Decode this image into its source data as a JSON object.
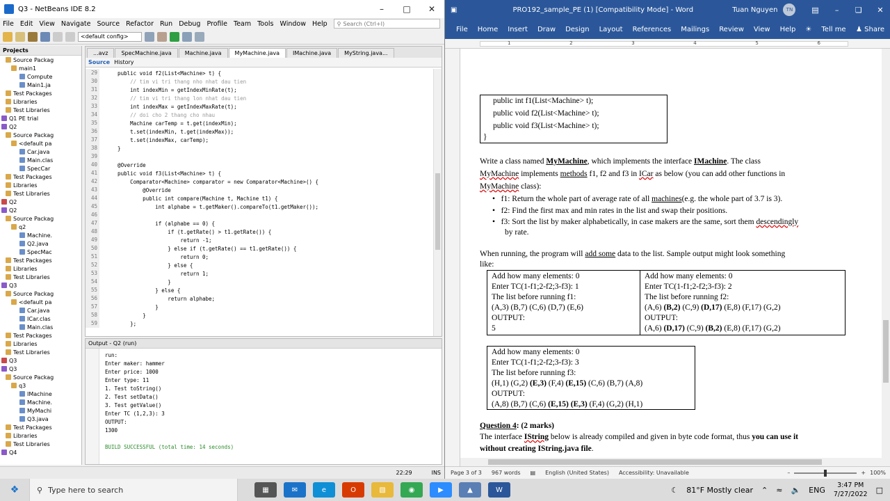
{
  "netbeans": {
    "title": "Q3 - NetBeans IDE 8.2",
    "menu": [
      "File",
      "Edit",
      "View",
      "Navigate",
      "Source",
      "Refactor",
      "Run",
      "Debug",
      "Profile",
      "Team",
      "Tools",
      "Window",
      "Help"
    ],
    "search_placeholder": "Search (Ctrl+I)",
    "config": "<default config>",
    "projects_tab": "Projects",
    "tree": [
      {
        "label": "Source Packag",
        "color": "#d9a84a"
      },
      {
        "label": "main1",
        "color": "#d9a84a"
      },
      {
        "label": "Compute",
        "color": "#6a8fc9"
      },
      {
        "label": "Main1.ja",
        "color": "#6a8fc9"
      },
      {
        "label": "Test Packages",
        "color": "#d9a84a"
      },
      {
        "label": "Libraries",
        "color": "#d9a84a"
      },
      {
        "label": "Test Libraries",
        "color": "#d9a84a"
      },
      {
        "label": "Q1 PE trial",
        "color": "#8a5ac9"
      },
      {
        "label": "Q2",
        "color": "#8a5ac9"
      },
      {
        "label": "Source Packag",
        "color": "#d9a84a"
      },
      {
        "label": "<default pa",
        "color": "#d9a84a"
      },
      {
        "label": "Car.java",
        "color": "#6a8fc9"
      },
      {
        "label": "Main.clas",
        "color": "#6a8fc9"
      },
      {
        "label": "SpecCar",
        "color": "#6a8fc9"
      },
      {
        "label": "Test Packages",
        "color": "#d9a84a"
      },
      {
        "label": "Libraries",
        "color": "#d9a84a"
      },
      {
        "label": "Test Libraries",
        "color": "#d9a84a"
      },
      {
        "label": "Q2",
        "color": "#c94a4a"
      },
      {
        "label": "Q2",
        "color": "#8a5ac9"
      },
      {
        "label": "Source Packag",
        "color": "#d9a84a"
      },
      {
        "label": "q2",
        "color": "#d9a84a"
      },
      {
        "label": "Machine.",
        "color": "#6a8fc9"
      },
      {
        "label": "Q2.java",
        "color": "#6a8fc9"
      },
      {
        "label": "SpecMac",
        "color": "#6a8fc9"
      },
      {
        "label": "Test Packages",
        "color": "#d9a84a"
      },
      {
        "label": "Libraries",
        "color": "#d9a84a"
      },
      {
        "label": "Test Libraries",
        "color": "#d9a84a"
      },
      {
        "label": "Q3",
        "color": "#8a5ac9"
      },
      {
        "label": "Source Packag",
        "color": "#d9a84a"
      },
      {
        "label": "<default pa",
        "color": "#d9a84a"
      },
      {
        "label": "Car.java",
        "color": "#6a8fc9"
      },
      {
        "label": "ICar.clas",
        "color": "#6a8fc9"
      },
      {
        "label": "Main.clas",
        "color": "#6a8fc9"
      },
      {
        "label": "Test Packages",
        "color": "#d9a84a"
      },
      {
        "label": "Libraries",
        "color": "#d9a84a"
      },
      {
        "label": "Test Libraries",
        "color": "#d9a84a"
      },
      {
        "label": "Q3",
        "color": "#c94a4a"
      },
      {
        "label": "Q3",
        "color": "#8a5ac9"
      },
      {
        "label": "Source Packag",
        "color": "#d9a84a"
      },
      {
        "label": "q3",
        "color": "#d9a84a"
      },
      {
        "label": "IMachine",
        "color": "#6a8fc9"
      },
      {
        "label": "Machine.",
        "color": "#6a8fc9"
      },
      {
        "label": "MyMachi",
        "color": "#6a8fc9"
      },
      {
        "label": "Q3.java",
        "color": "#6a8fc9"
      },
      {
        "label": "Test Packages",
        "color": "#d9a84a"
      },
      {
        "label": "Libraries",
        "color": "#d9a84a"
      },
      {
        "label": "Test Libraries",
        "color": "#d9a84a"
      },
      {
        "label": "Q4",
        "color": "#8a5ac9"
      }
    ],
    "tabs": [
      "...avz",
      "SpecMachine.java",
      "Machine.java",
      "MyMachine.java",
      "IMachine.java",
      "MyString.java..."
    ],
    "source_tab": "Source",
    "history_tab": "History",
    "code": [
      {
        "n": "29",
        "t": "    public void f2(List<Machine> t) {"
      },
      {
        "n": "30",
        "t": "        // tim vi tri thang nho nhat dau tien",
        "c": true
      },
      {
        "n": "31",
        "t": "        int indexMin = getIndexMinRate(t);"
      },
      {
        "n": "32",
        "t": "        // tim vi tri thang lon nhat dau tien",
        "c": true
      },
      {
        "n": "33",
        "t": "        int indexMax = getIndexMaxRate(t);"
      },
      {
        "n": "34",
        "t": "        // doi cho 2 thang cho nhau",
        "c": true
      },
      {
        "n": "35",
        "t": "        Machine carTemp = t.get(indexMin);"
      },
      {
        "n": "36",
        "t": "        t.set(indexMin, t.get(indexMax));"
      },
      {
        "n": "37",
        "t": "        t.set(indexMax, carTemp);"
      },
      {
        "n": "38",
        "t": "    }"
      },
      {
        "n": "39",
        "t": ""
      },
      {
        "n": "40",
        "t": "    @Override"
      },
      {
        "n": "41",
        "t": "    public void f3(List<Machine> t) {"
      },
      {
        "n": "42",
        "t": "        Comparator<Machine> comparator = new Comparator<Machine>() {"
      },
      {
        "n": "43",
        "t": "            @Override"
      },
      {
        "n": "44",
        "t": "            public int compare(Machine t, Machine t1) {"
      },
      {
        "n": "45",
        "t": "                int alphabe = t.getMaker().compareTo(t1.getMaker());"
      },
      {
        "n": "46",
        "t": ""
      },
      {
        "n": "47",
        "t": "                if (alphabe == 0) {"
      },
      {
        "n": "48",
        "t": "                    if (t.getRate() > t1.getRate()) {"
      },
      {
        "n": "49",
        "t": "                        return -1;"
      },
      {
        "n": "50",
        "t": "                    } else if (t.getRate() == t1.getRate()) {"
      },
      {
        "n": "51",
        "t": "                        return 0;"
      },
      {
        "n": "52",
        "t": "                    } else {"
      },
      {
        "n": "53",
        "t": "                        return 1;"
      },
      {
        "n": "54",
        "t": "                    }"
      },
      {
        "n": "55",
        "t": "                } else {"
      },
      {
        "n": "56",
        "t": "                    return alphabe;"
      },
      {
        "n": "57",
        "t": "                }"
      },
      {
        "n": "58",
        "t": "            }"
      },
      {
        "n": "59",
        "t": "        };"
      }
    ],
    "output_title": "Output - Q2 (run)",
    "output": [
      {
        "t": "run:"
      },
      {
        "t": "Enter maker: hammer"
      },
      {
        "t": "Enter price: 1000"
      },
      {
        "t": "Enter type: 11"
      },
      {
        "t": "1. Test toString()"
      },
      {
        "t": "2. Test setData()"
      },
      {
        "t": "3. Test getValue()"
      },
      {
        "t": "Enter TC (1,2,3): 3"
      },
      {
        "t": "OUTPUT:"
      },
      {
        "t": "1300"
      },
      {
        "t": ""
      },
      {
        "t": "BUILD SUCCESSFUL (total time: 14 seconds)",
        "ok": true
      }
    ],
    "status_pos": "22:29",
    "status_mode": "INS"
  },
  "word": {
    "title": "PRO192_sample_PE (1) [Compatibility Mode] - Word",
    "user": "Tuan Nguyen",
    "user_initials": "TN",
    "ribbon": [
      "File",
      "Home",
      "Insert",
      "Draw",
      "Design",
      "Layout",
      "References",
      "Mailings",
      "Review",
      "View",
      "Help"
    ],
    "tell_me": "Tell me",
    "share": "Share",
    "ruler": [
      "1",
      "2",
      "3",
      "4",
      "5",
      "6"
    ],
    "interface_box": [
      "public int f1(List<Machine> t);",
      "public void f2(List<Machine> t);",
      "public void f3(List<Machine> t);",
      "}"
    ],
    "para": {
      "l1a": "Write a class named ",
      "l1b": "MyMachine",
      "l1c": ", which implements the interface ",
      "l1d": "IMachine",
      "l1e": ". The class",
      "l2a": "MyMachine",
      "l2b": " implements ",
      "l2c": "methods",
      "l2d": "  f1, f2 and f3 in ",
      "l2e": "ICar",
      "l2f": " as below (you can add other functions in",
      "l3a": "MyMachine",
      "l3b": " class):"
    },
    "bullets": {
      "b1a": "f1: Return the whole part of average rate of all ",
      "b1b": "machines",
      "b1c": "(e.g. the whole part of 3.7 is 3).",
      "b2": "f2: Find the first max and min rates in the list and swap their positions.",
      "b3a": "f3: Sort the list by maker alphabetically, in case makers are the same, sort them ",
      "b3b": "descendingly",
      "b3c": "by rate."
    },
    "running": {
      "r1a": "When running, the program will ",
      "r1b": "add  some",
      "r1c": " data to the list. Sample output might look something",
      "r2": "like:"
    },
    "sample1": [
      "Add how many elements: 0",
      "Enter TC(1-f1;2-f2;3-f3): 1",
      "The list before running f1:",
      "(A,3) (B,7) (C,6) (D,7) (E,6)",
      "OUTPUT:",
      "5"
    ],
    "sample2": {
      "l1": "Add how many elements: 0",
      "l2": "Enter TC(1-f1;2-f2;3-f3): 2",
      "l3": "The list before running f2:",
      "l4a": "(A,6) ",
      "l4b": "(B,2)",
      "l4c": " (C,9) ",
      "l4d": "(D,17)",
      "l4e": " (E,8) (F,17) (G,2)",
      "l5": "OUTPUT:",
      "l6a": "(A,6) ",
      "l6b": "(D,17)",
      "l6c": " (C,9) ",
      "l6d": "(B,2)",
      "l6e": " (E,8) (F,17) (G,2)"
    },
    "sample3": {
      "l1": "Add how many elements: 0",
      "l2": "Enter TC(1-f1;2-f2;3-f3): 3",
      "l3": "The list before running f3:",
      "l4a": "(H,1) (G,2) ",
      "l4b": "(E,3)",
      "l4c": " (F,4) ",
      "l4d": "(E,15)",
      "l4e": " (C,6) (B,7) (A,8)",
      "l5": "OUTPUT:",
      "l6a": "(A,8) (B,7) (C,6) ",
      "l6b": "(E,15) (E,3)",
      "l6c": " (F,4) (G,2) (H,1)"
    },
    "q4": {
      "h1": "Question 4",
      "h2": ": (2 marks)",
      "p1a": "The interface ",
      "p1b": "IString",
      "p1c": " below is already compiled and given in byte code format, thus ",
      "p1d": "you can use it",
      "p2": "without creating IString.java file",
      "p2b": "."
    },
    "status": {
      "page": "Page 3 of 3",
      "words": "967 words",
      "lang": "English (United States)",
      "access": "Accessibility: Unavailable",
      "zoom": "100%"
    }
  },
  "taskbar": {
    "search_placeholder": "Type here to search",
    "weather": "81°F  Mostly clear",
    "lang": "ENG",
    "time": "3:47 PM",
    "date": "7/27/2022"
  }
}
